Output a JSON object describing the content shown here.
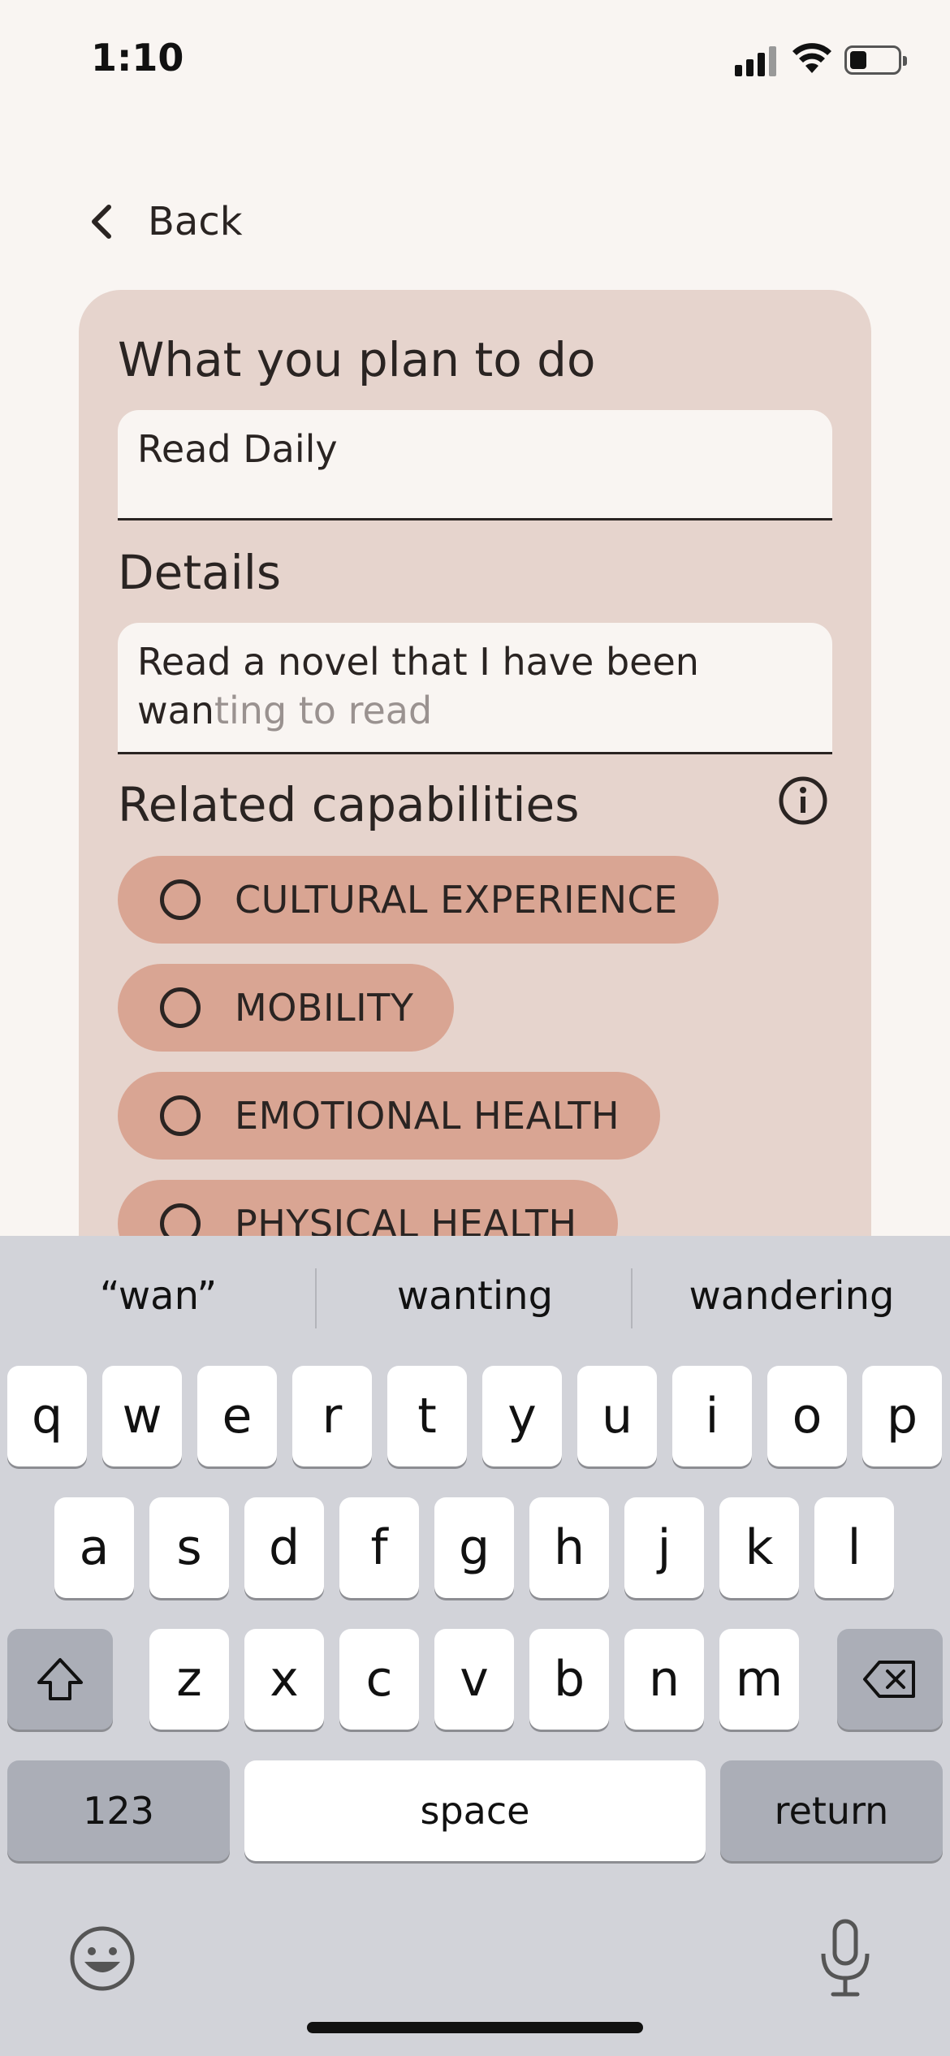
{
  "status": {
    "time": "1:10"
  },
  "nav": {
    "back_label": "Back"
  },
  "form": {
    "plan_title": "What you plan to do",
    "plan_value": "Read Daily",
    "details_title": "Details",
    "details_value_line1": "Read a novel that I have been",
    "details_value_line2_typed": "wan",
    "details_value_line2_suggestion": "ting to read",
    "capabilities_title": "Related capabilities",
    "capabilities": [
      {
        "label": "CULTURAL EXPERIENCE"
      },
      {
        "label": "MOBILITY"
      },
      {
        "label": "EMOTIONAL HEALTH"
      },
      {
        "label": "PHYSICAL HEALTH"
      }
    ]
  },
  "keyboard": {
    "suggestions": [
      "“wan”",
      "wanting",
      "wandering"
    ],
    "row1": [
      "q",
      "w",
      "e",
      "r",
      "t",
      "y",
      "u",
      "i",
      "o",
      "p"
    ],
    "row2": [
      "a",
      "s",
      "d",
      "f",
      "g",
      "h",
      "j",
      "k",
      "l"
    ],
    "row3": [
      "z",
      "x",
      "c",
      "v",
      "b",
      "n",
      "m"
    ],
    "numbers_label": "123",
    "space_label": "space",
    "return_label": "return"
  },
  "icons": {
    "back": "chevron-left-icon",
    "info": "info-icon",
    "shift": "shift-icon",
    "delete": "delete-icon",
    "emoji": "emoji-icon",
    "mic": "microphone-icon"
  }
}
